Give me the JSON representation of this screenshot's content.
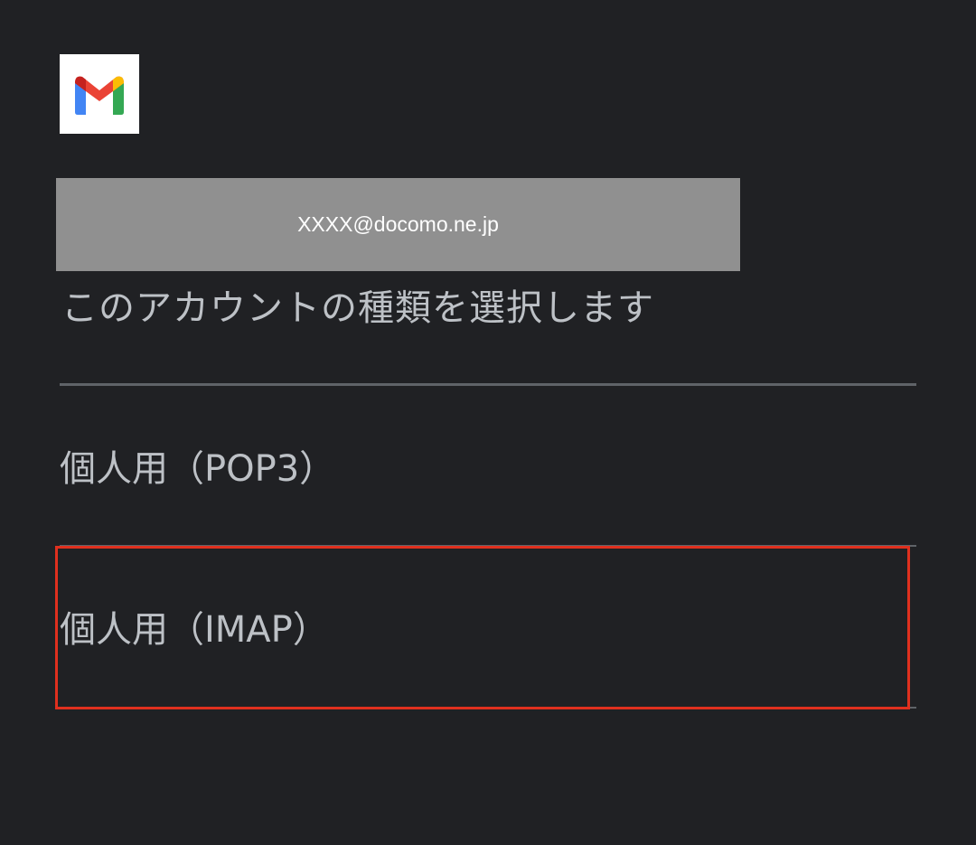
{
  "app": {
    "logo_icon": "gmail-logo-icon"
  },
  "account": {
    "email": "XXXX@docomo.ne.jp"
  },
  "prompt": {
    "text": "このアカウントの種類を選択します"
  },
  "options": [
    {
      "label": "個人用（POP3）"
    },
    {
      "label": "個人用（IMAP）"
    }
  ],
  "colors": {
    "background": "#202124",
    "text": "#bdc1c6",
    "divider": "#5f6368",
    "account_box": "#909090",
    "highlight": "#e0301e",
    "gmail_red": "#ea4335",
    "gmail_blue": "#4285f4",
    "gmail_green": "#34a853",
    "gmail_yellow": "#fbbc04",
    "gmail_darkred": "#c5221f"
  }
}
